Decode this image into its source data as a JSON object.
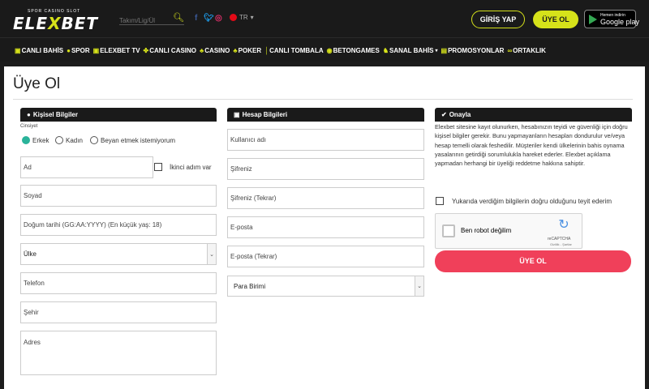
{
  "header": {
    "logo_tagline": "SPOR CASINO SLOT",
    "logo_part1": "ELE",
    "logo_part2": "X",
    "logo_part3": "BET",
    "search_placeholder": "Takım/Lig/Ül",
    "lang": "TR",
    "login_label": "GİRİŞ YAP",
    "register_label": "ÜYE OL",
    "gplay_small": "Hemen indirin",
    "gplay_large": "Google play"
  },
  "nav": [
    {
      "label": "CANLI BAHİS"
    },
    {
      "label": "SPOR"
    },
    {
      "label": "ELEXBET TV"
    },
    {
      "label": "CANLI CASINO"
    },
    {
      "label": "CASINO"
    },
    {
      "label": "POKER"
    },
    {
      "label": "CANLI TOMBALA"
    },
    {
      "label": "BETONGAMES"
    },
    {
      "label": "SANAL BAHİS"
    },
    {
      "label": "PROMOSYONLAR"
    },
    {
      "label": "ORTAKLIK"
    }
  ],
  "page": {
    "title": "Üye Ol"
  },
  "personal": {
    "heading": "Kişisel Bilgiler",
    "gender_label": "Cinsiyet",
    "gender_male": "Erkek",
    "gender_female": "Kadın",
    "gender_none": "Beyan etmek istemiyorum",
    "name_placeholder": "Ad",
    "second_name": "İkinci adım var",
    "surname_placeholder": "Soyad",
    "birth_placeholder": "Doğum tarihi (GG:AA:YYYY) (En küçük yaş: 18)",
    "country_value": "Ülke",
    "phone_placeholder": "Telefon",
    "city_placeholder": "Şehir",
    "address_placeholder": "Adres"
  },
  "account": {
    "heading": "Hesap Bilgileri",
    "username_placeholder": "Kullanıcı adı",
    "password_placeholder": "Şifreniz",
    "password2_placeholder": "Şifreniz (Tekrar)",
    "email_placeholder": "E-posta",
    "email2_placeholder": "E-posta (Tekrar)",
    "currency_value": "Para Birimi"
  },
  "confirm": {
    "heading": "Onayla",
    "description": "Elexbet sitesine kayıt olunurken, hesabınızın teyidi ve güvenliği için doğru kişisel bilgiler gerekir. Bunu yapmayanların hesapları dondurulur ve/veya hesap temelli olarak feshedilir. Müşteriler kendi ülkelerinin bahis oynama yasalarının getirdiği sorumlulukla hareket ederler. Elexbet açıklama yapmadan herhangi bir üyeliği reddetme hakkına sahiptir.",
    "agree_label": "Yukarıda verdiğim bilgilerin doğru olduğunu teyit ederim",
    "captcha_text": "Ben robot değilim",
    "captcha_brand": "reCAPTCHA",
    "captcha_links": "Gizlilik - Şartlar",
    "submit_label": "ÜYE OL"
  },
  "colors": {
    "accent": "#d6e21a",
    "submit": "#f0405a",
    "radio": "#2ab39a",
    "dark": "#1a1a1a"
  }
}
